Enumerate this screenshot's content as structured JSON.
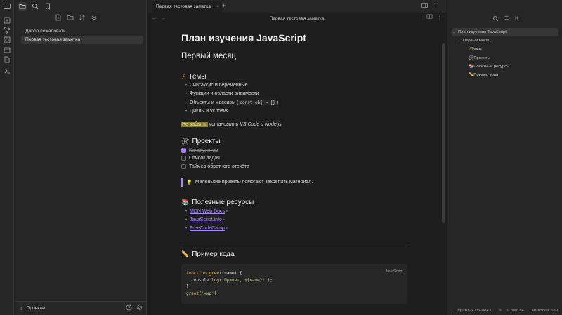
{
  "tab": {
    "title": "Первая тестовая заметка"
  },
  "editor_header": {
    "title": "Первая тестовая заметка"
  },
  "files": [
    {
      "name": "Добро пожаловать",
      "active": false
    },
    {
      "name": "Первая тестовая заметка",
      "active": true
    }
  ],
  "vault": {
    "name": "Проекты"
  },
  "doc": {
    "h1": "План изучения JavaScript",
    "h2": "Первый месяц",
    "topics_heading": "Темы",
    "topics": [
      {
        "text": "Синтаксис и переменные"
      },
      {
        "text": "Функции и области видимости"
      },
      {
        "text": "Объекты и массивы",
        "code": "const obj = {}"
      },
      {
        "text": "Циклы и условия"
      }
    ],
    "note_highlight": "Не забыть:",
    "note_italic": "установить VS Code и Node.js",
    "projects_heading": "Проекты",
    "tasks": [
      {
        "text": "Калькулятор",
        "done": true
      },
      {
        "text": "Список задач",
        "done": false
      },
      {
        "text": "Таймер обратного отсчёта",
        "done": false
      }
    ],
    "callout": "Маленькие проекты помогают закрепить материал.",
    "resources_heading": "Полезные ресурсы",
    "resources": [
      {
        "text": "MDN Web Docs"
      },
      {
        "text": "JavaScript.info"
      },
      {
        "text": "FreeCodeCamp"
      }
    ],
    "code_heading": "Пример кода",
    "code_lang": "JavaScript",
    "code": {
      "l1_kw": "function",
      "l1_fn": " greet",
      "l1_rest": "(name) {",
      "l2_a": "  console.",
      "l2_fn": "log",
      "l2_b": "(",
      "l2_str": "`Привет, ${name}!`",
      "l2_c": ");",
      "l3": "}",
      "l4_fn": "greet",
      "l4_a": "(",
      "l4_str": "'мир'",
      "l4_b": ");"
    }
  },
  "outline": [
    {
      "text": "План изучения JavaScript",
      "level": 1
    },
    {
      "text": "Первый месяц",
      "level": 2
    },
    {
      "text": "Темы",
      "level": 3
    },
    {
      "text": "Проекты",
      "level": 3
    },
    {
      "text": "Полезные ресурсы",
      "level": 3
    },
    {
      "text": "Пример кода",
      "level": 3
    }
  ],
  "status": {
    "backlinks": "Обратных ссылок: 0",
    "words": "Слов: 84",
    "chars": "Символов: 639"
  },
  "colors": {
    "accent": "#a882ff",
    "highlight": "#847b2b",
    "bg": "#1e1e1e",
    "panel": "#262626"
  }
}
